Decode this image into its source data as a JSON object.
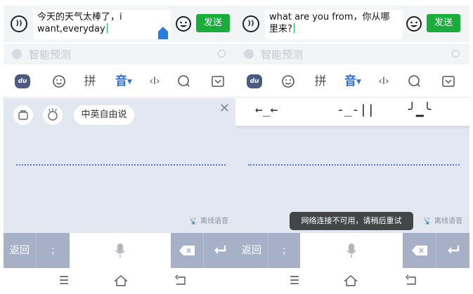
{
  "left": {
    "message_text": "今天的天气太棒了，i want,everyday",
    "send_label": "发送",
    "predict_label": "智能预测",
    "toolbar": {
      "du_label": "du",
      "pinyin": "拼",
      "voice": "音"
    },
    "chip_label": "中英自由说",
    "offline_label": "离线语音",
    "keys": {
      "back": "返回",
      "semicolon": ";"
    }
  },
  "right": {
    "message_text": "what are you from，你从哪里来?",
    "send_label": "发送",
    "predict_label": "智能预测",
    "toolbar": {
      "du_label": "du",
      "pinyin": "拼",
      "voice": "音"
    },
    "emoticons": [
      "←_←",
      "-_-||",
      "╯▁╰"
    ],
    "offline_label": "离线语音",
    "toast": "网络连接不可用，请稍后重试",
    "keys": {
      "back": "返回",
      "semicolon": ";"
    }
  },
  "colors": {
    "accent_green": "#1aad3b",
    "active_blue": "#2f6bd6",
    "voice_bg": "#e3e7f2",
    "key_gray": "#a6b1c8"
  },
  "icons": [
    "voice-input-icon",
    "emoji-icon",
    "du-logo-icon",
    "smiley-icon",
    "cursor-move-icon",
    "search-icon",
    "keyboard-hide-icon",
    "briefcase-icon",
    "gesture-icon",
    "close-icon",
    "mic-icon",
    "delete-icon",
    "enter-icon",
    "menu-icon",
    "home-icon",
    "back-icon"
  ]
}
